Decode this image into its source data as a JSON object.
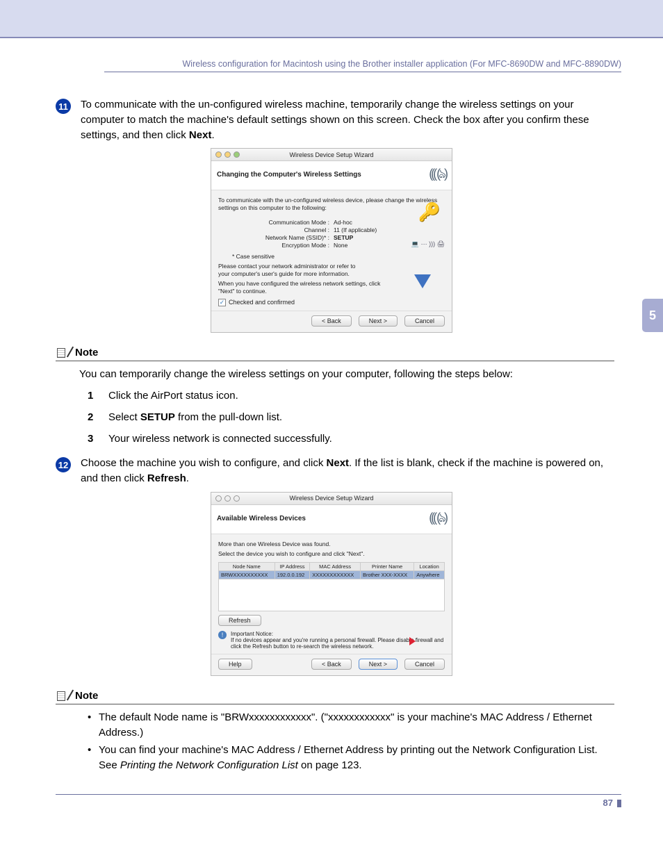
{
  "chapter": "5",
  "header": "Wireless configuration for Macintosh using the Brother installer application (For MFC-8690DW and MFC-8890DW)",
  "step11": {
    "num": "11",
    "text_a": "To communicate with the un-configured wireless machine, temporarily change the wireless settings on your computer to match the machine's default settings shown on this screen. Check the box after you confirm these settings, and then click ",
    "bold": "Next",
    "text_b": "."
  },
  "wiz1": {
    "title": "Wireless Device Setup Wizard",
    "banner": "Changing the Computer's Wireless Settings",
    "intro": "To communicate with the un-configured wireless device, please change the wireless settings on this computer to the following:",
    "settings": {
      "comm_mode_lbl": "Communication Mode :",
      "comm_mode_val": "Ad-hoc",
      "channel_lbl": "Channel :",
      "channel_val": "11  (If applicable)",
      "ssid_lbl": "Network Name (SSID)* :",
      "ssid_val": "SETUP",
      "enc_lbl": "Encryption Mode :",
      "enc_val": "None"
    },
    "case": "* Case sensitive",
    "contact": "Please contact your network administrator or refer to your computer's user's guide for more information.",
    "when": "When you have configured the wireless network settings, click \"Next\" to continue.",
    "checked": "Checked and confirmed",
    "back": "< Back",
    "next": "Next >",
    "cancel": "Cancel"
  },
  "note1": {
    "label": "Note",
    "body": "You can temporarily change the wireless settings on your computer, following the steps below:",
    "s1": "Click the AirPort status icon.",
    "s2_a": "Select ",
    "s2_b": "SETUP",
    "s2_c": " from the pull-down list.",
    "s3": "Your wireless network is connected successfully."
  },
  "step12": {
    "num": "12",
    "a": "Choose the machine you wish to configure, and click ",
    "b1": "Next",
    "c": ". If the list is blank, check if the machine is powered on, and then click ",
    "b2": "Refresh",
    "d": "."
  },
  "wiz2": {
    "title": "Wireless Device Setup Wizard",
    "banner": "Available Wireless Devices",
    "intro1": "More than one Wireless Device was found.",
    "intro2": "Select the device you wish to configure and click \"Next\".",
    "headers": {
      "h1": "Node Name",
      "h2": "IP Address",
      "h3": "MAC Address",
      "h4": "Printer Name",
      "h5": "Location"
    },
    "row": {
      "c1": "BRWXXXXXXXXXX",
      "c2": "192.0.0.192",
      "c3": "XXXXXXXXXXXX",
      "c4": "Brother XXX-XXXX",
      "c5": "Anywhere"
    },
    "refresh": "Refresh",
    "notice_lbl": "Important Notice:",
    "notice": "If no devices appear and you're running a personal firewall. Please disable     firewall and click the Refresh button to re-search the wireless network.",
    "help": "Help",
    "back": "< Back",
    "next": "Next >",
    "cancel": "Cancel"
  },
  "note2": {
    "label": "Note",
    "b1": "The default Node name is \"BRWxxxxxxxxxxxx\". (\"xxxxxxxxxxxx\" is your machine's MAC Address / Ethernet Address.)",
    "b2_a": "You can find your machine's MAC Address / Ethernet Address by printing out the Network Configuration List. See ",
    "b2_ref": "Printing the Network Configuration List",
    "b2_b": " on page 123."
  },
  "page_number": "87"
}
